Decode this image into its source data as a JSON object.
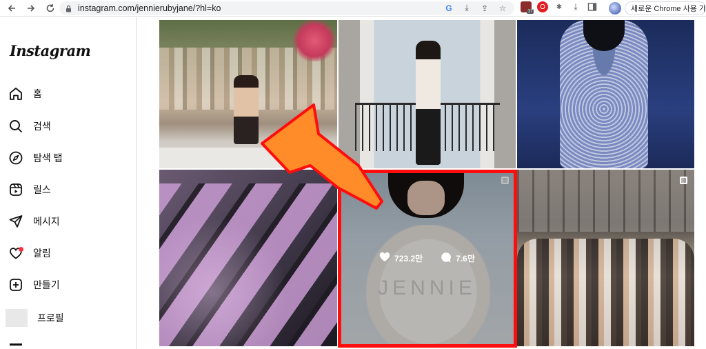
{
  "browser": {
    "url": "instagram.com/jennierubyjane/?hl=ko",
    "profile_chip_label": "새로운 Chrome 사용 가능",
    "extension_badge": "17"
  },
  "sidebar": {
    "logo": "Instagram",
    "items": [
      {
        "label": "홈",
        "icon": "home-icon"
      },
      {
        "label": "검색",
        "icon": "search-icon"
      },
      {
        "label": "탐색 탭",
        "icon": "compass-icon"
      },
      {
        "label": "릴스",
        "icon": "reels-icon"
      },
      {
        "label": "메시지",
        "icon": "send-icon"
      },
      {
        "label": "알림",
        "icon": "heart-icon"
      },
      {
        "label": "만들기",
        "icon": "plus-square-icon"
      },
      {
        "label": "프로필",
        "icon": "profile-avatar"
      }
    ]
  },
  "grid": {
    "hovered_post": {
      "likes": "723.2만",
      "comments": "7.6만",
      "watermark": "JENNIE"
    }
  },
  "colors": {
    "highlight": "#ff0d0d",
    "arrow": "#ff8c28",
    "notification_dot": "#ff3040"
  }
}
